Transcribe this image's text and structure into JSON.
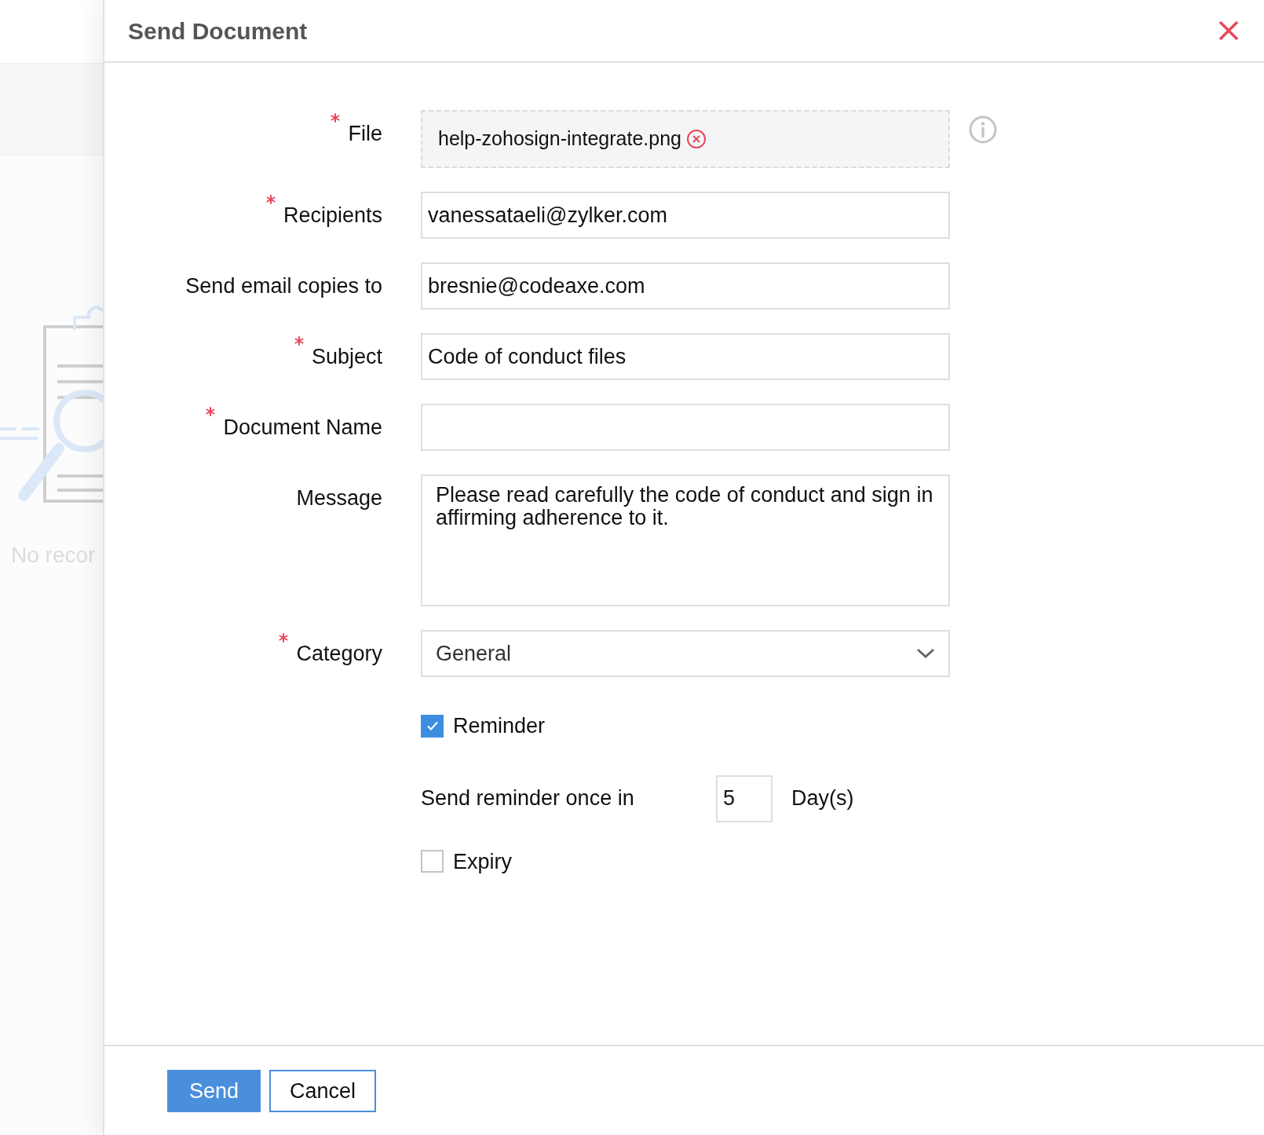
{
  "background": {
    "empty_text": "No recor"
  },
  "dialog": {
    "title": "Send Document"
  },
  "fields": [
    {
      "kind": "file",
      "label": "File",
      "required": true,
      "value": "help-zohosign-integrate.png"
    },
    {
      "kind": "text",
      "label": "Recipients",
      "required": true,
      "value": "vanessataeli@zylker.com"
    },
    {
      "kind": "text",
      "label": "Send email copies to",
      "required": false,
      "value": "bresnie@codeaxe.com"
    },
    {
      "kind": "text",
      "label": "Subject",
      "required": true,
      "value": "Code of conduct files"
    },
    {
      "kind": "text",
      "label": "Document Name",
      "required": true
    },
    {
      "kind": "textarea",
      "label": "Message",
      "required": false,
      "value": "Please read carefully the code of conduct and sign in affirming adherence to it."
    },
    {
      "kind": "select",
      "label": "Category",
      "required": true,
      "value": "General"
    }
  ],
  "reminder": {
    "label": "Reminder",
    "checked": true
  },
  "reminder_interval": {
    "label": "Send reminder once in",
    "value": "5",
    "unit": "Day(s)"
  },
  "expiry": {
    "label": "Expiry",
    "checked": false
  },
  "buttons": [
    {
      "kind": "primary",
      "label": "Send"
    },
    {
      "kind": "secondary",
      "label": "Cancel"
    }
  ]
}
